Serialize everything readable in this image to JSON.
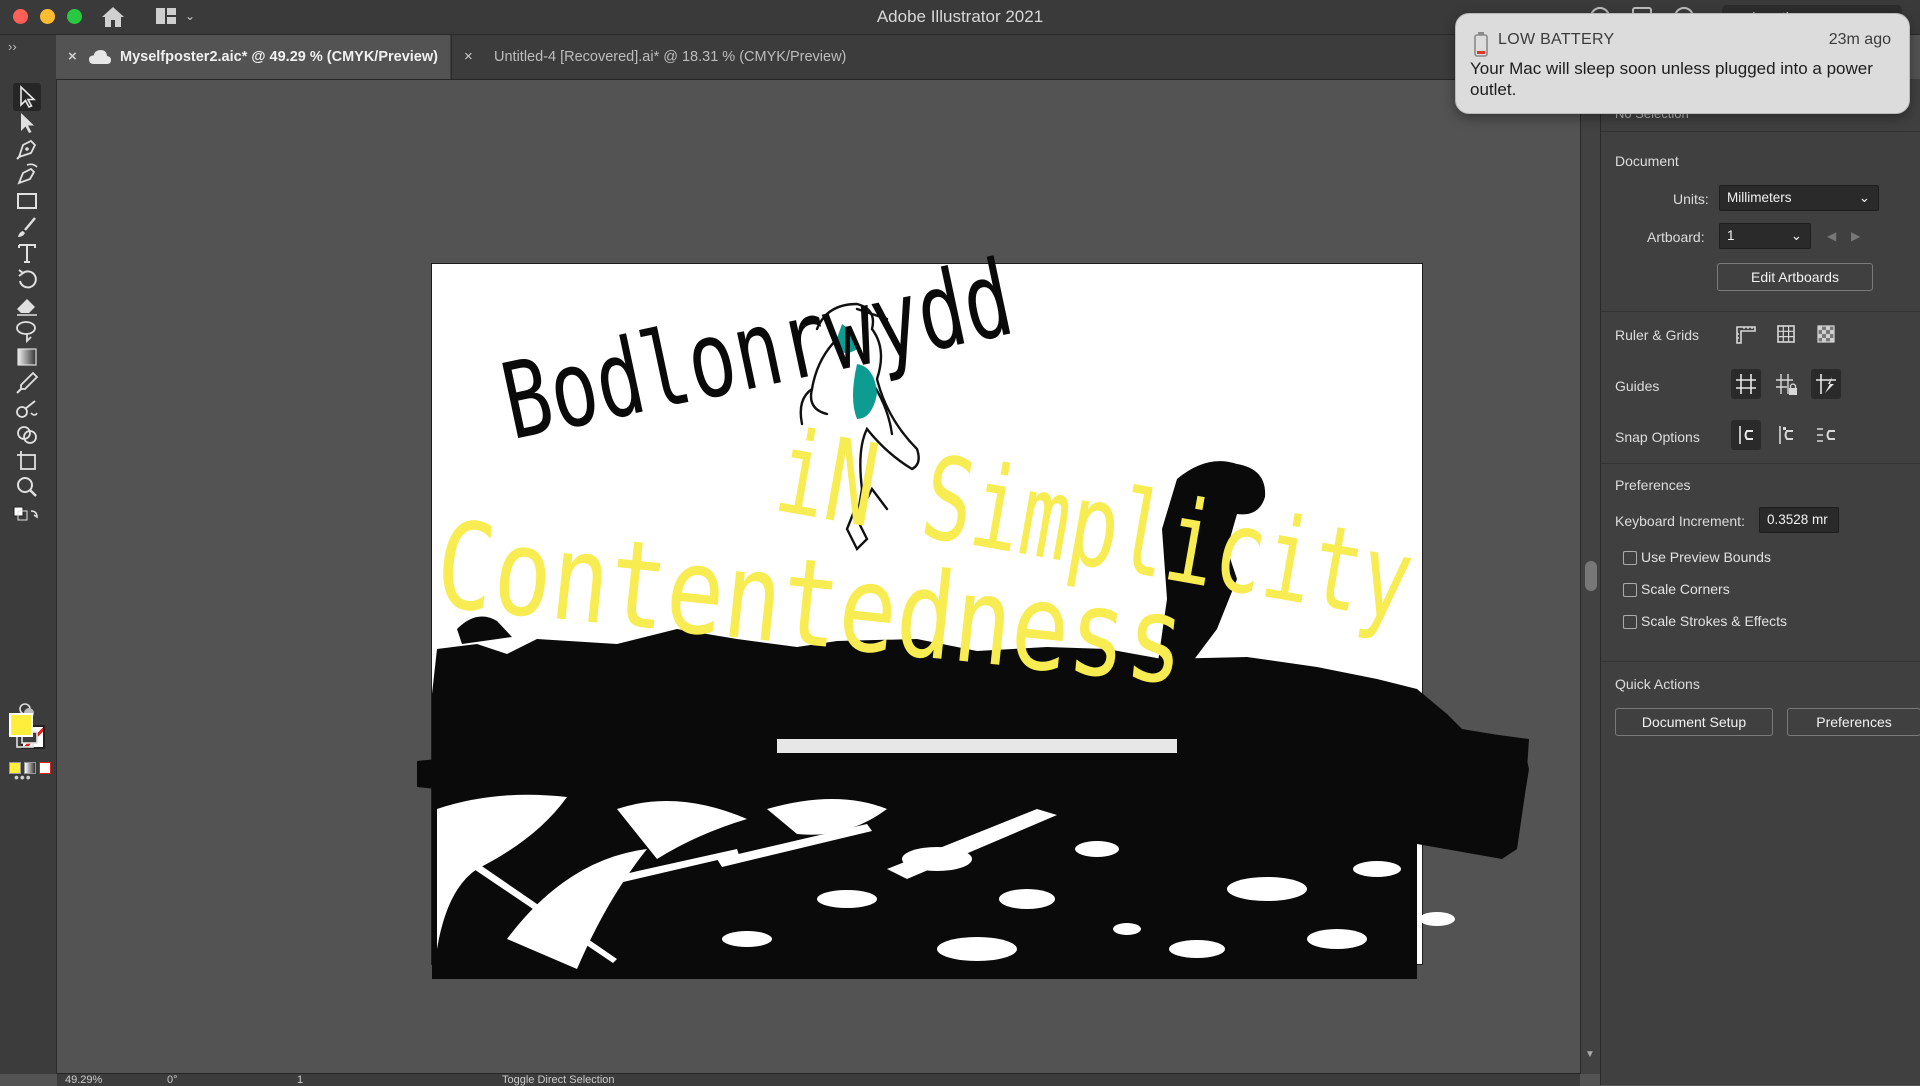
{
  "window": {
    "title": "Adobe Illustrator 2021",
    "search_text": "undo action"
  },
  "tabs": [
    {
      "label": "Myselfposter2.aic* @ 49.29 % (CMYK/Preview)",
      "active": true
    },
    {
      "label": "Untitled-4 [Recovered].ai* @ 18.31 % (CMYK/Preview)",
      "active": false
    }
  ],
  "collapse_label": "››",
  "artwork": {
    "heading": "Bodlonrwydd",
    "main_text": "Contentedness",
    "secondary_text": "iN Simplicity",
    "accent_yellow": "#f7ec52",
    "accent_teal": "#0d9c92"
  },
  "tools": {
    "fill_color": "#ffef3c",
    "more_label": "•••",
    "items": [
      "selection",
      "direct-selection",
      "pen",
      "curvature",
      "rectangle",
      "paintbrush",
      "type",
      "rotate",
      "eraser",
      "lasso",
      "gradient",
      "eyedropper",
      "blend",
      "shape-builder",
      "artboard",
      "zoom"
    ]
  },
  "status": {
    "zoom": "49.29%",
    "rotation": "0°",
    "artboard": "1",
    "tool_hint": "Toggle Direct Selection"
  },
  "notification": {
    "title": "LOW BATTERY",
    "time": "23m ago",
    "body": "Your Mac will sleep soon unless plugged into a power outlet."
  },
  "panel": {
    "selection_state": "No Selection",
    "document": {
      "heading": "Document",
      "units_label": "Units:",
      "units_value": "Millimeters",
      "artboard_label": "Artboard:",
      "artboard_value": "1",
      "edit_artboards": "Edit Artboards"
    },
    "ruler_grids": "Ruler & Grids",
    "guides": "Guides",
    "snap_options": "Snap Options",
    "preferences": {
      "heading": "Preferences",
      "keyboard_increment_label": "Keyboard Increment:",
      "keyboard_increment_value": "0.3528 mr",
      "options": [
        "Use Preview Bounds",
        "Scale Corners",
        "Scale Strokes & Effects"
      ]
    },
    "quick_actions": {
      "heading": "Quick Actions",
      "document_setup": "Document Setup",
      "preferences": "Preferences"
    }
  }
}
